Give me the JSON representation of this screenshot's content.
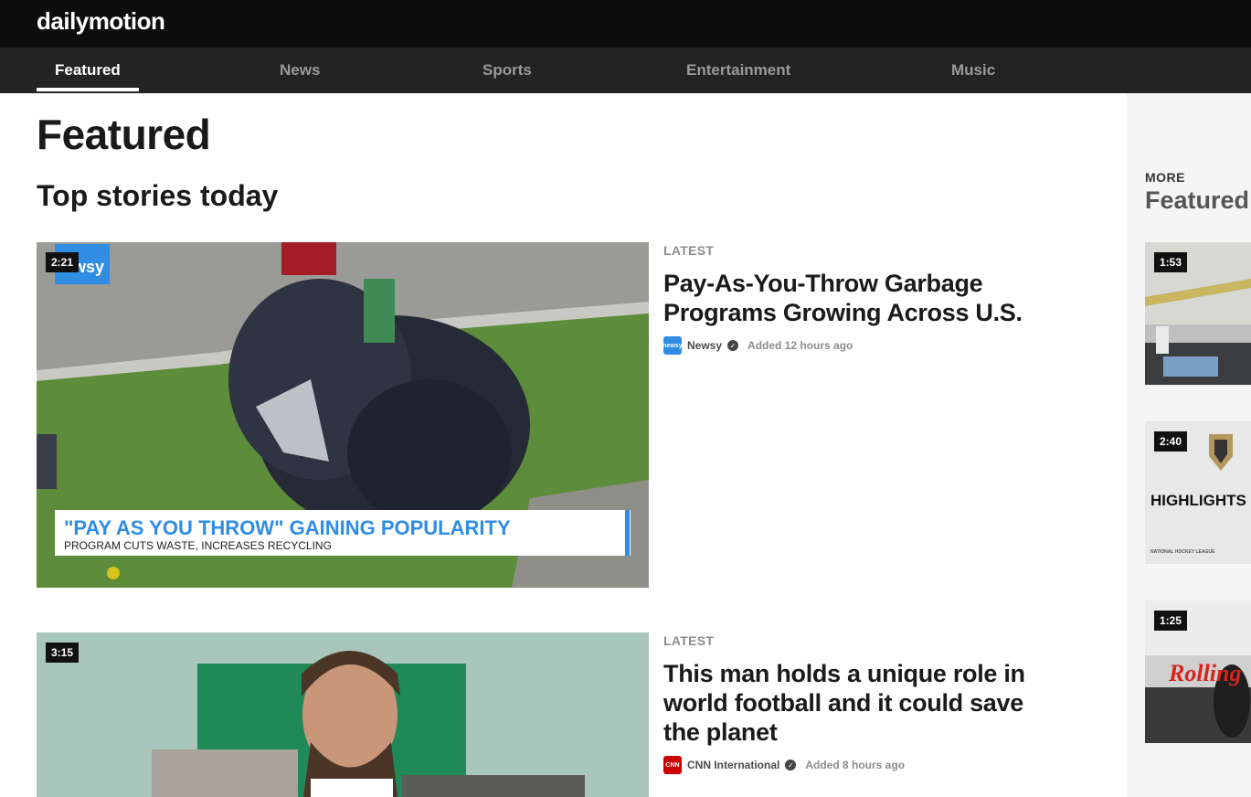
{
  "header": {
    "logo": "dailymotion"
  },
  "nav": {
    "tabs": [
      {
        "label": "Featured",
        "active": true
      },
      {
        "label": "News"
      },
      {
        "label": "Sports"
      },
      {
        "label": "Entertainment"
      },
      {
        "label": "Music"
      }
    ]
  },
  "main": {
    "page_title": "Featured",
    "section_title": "Top stories today",
    "stories": [
      {
        "duration": "2:21",
        "label": "LATEST",
        "title": "Pay-As-You-Throw Garbage Programs Growing Across U.S.",
        "channel": "Newsy",
        "channel_icon": "newsy",
        "added": "Added 12 hours ago",
        "thumb_watermark": "wsy",
        "overlay_headline": "\"PAY AS YOU THROW\" GAINING POPULARITY",
        "overlay_subhead": "PROGRAM CUTS WASTE, INCREASES RECYCLING"
      },
      {
        "duration": "3:15",
        "label": "LATEST",
        "title": "This man holds a unique role in world football and it could save the planet",
        "channel": "CNN International",
        "channel_icon": "CNN",
        "added": "Added 8 hours ago"
      }
    ]
  },
  "sidebar": {
    "more_label": "MORE",
    "more_title": "Featured",
    "cards": [
      {
        "duration": "1:53"
      },
      {
        "duration": "2:40",
        "thumb_text": "HIGHLIGHTS",
        "thumb_small": "NATIONAL HOCKEY LEAGUE"
      },
      {
        "duration": "1:25",
        "thumb_text": "Rolling"
      }
    ]
  },
  "colors": {
    "topbar": "#0d0d0d",
    "navbar": "#232323",
    "newsy_blue": "#2f8de4",
    "cnn_red": "#cc0000"
  }
}
